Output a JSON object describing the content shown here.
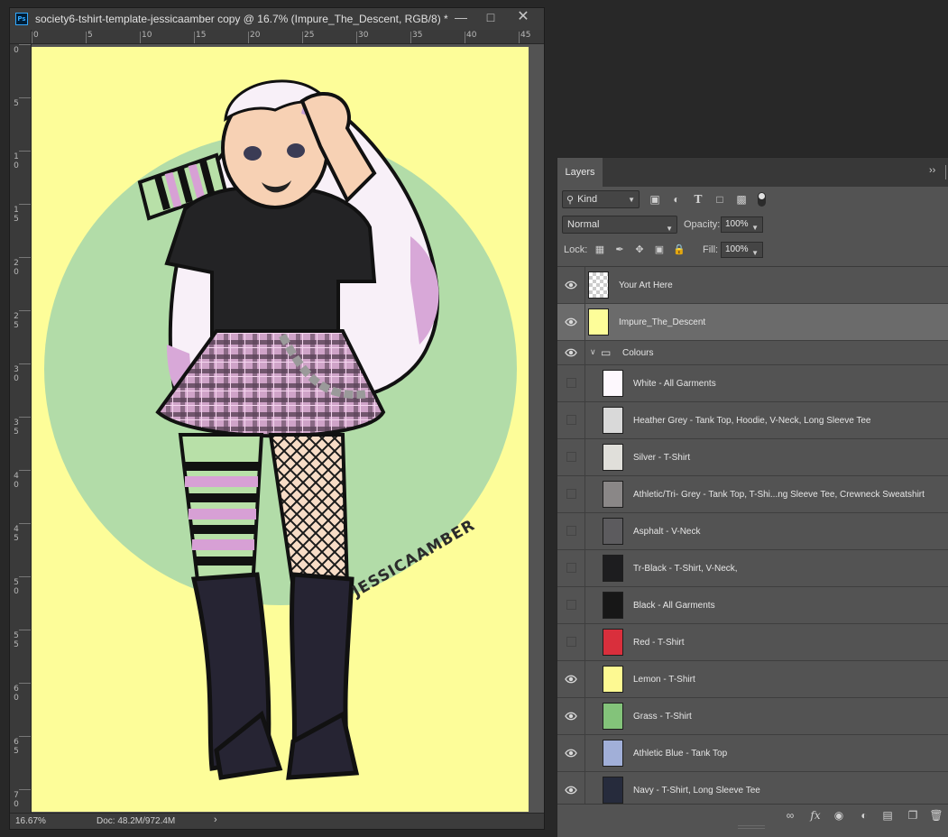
{
  "document": {
    "title": "society6-tshirt-template-jessicaamber copy @ 16.7% (Impure_The_Descent, RGB/8) *",
    "app_icon": "Ps",
    "zoom": "16.67%",
    "doc_size": "Doc: 48.2M/972.4M",
    "ruler_top": [
      "0",
      "5",
      "10",
      "15",
      "20",
      "25",
      "30",
      "35",
      "40",
      "45"
    ],
    "ruler_left": [
      "0",
      "5",
      "10",
      "15",
      "20",
      "25",
      "30",
      "35",
      "40",
      "45",
      "50",
      "55",
      "60",
      "65",
      "70"
    ],
    "artwork_signature": "JESSICAAMBER",
    "canvas_color": "#fdfd99",
    "circle_color": "#b2dca8"
  },
  "layers_panel": {
    "tab": "Layers",
    "menu_icon": "double-chevron-right-icon",
    "filter_kind": "Kind",
    "blend_mode": "Normal",
    "opacity_label": "Opacity:",
    "opacity": "100%",
    "lock_label": "Lock:",
    "fill_label": "Fill:",
    "fill": "100%",
    "layers": [
      {
        "name": "Your Art Here",
        "visible": true,
        "thumb": "#ffffff",
        "transparent": true,
        "indent": 0,
        "selected": false
      },
      {
        "name": "Impure_The_Descent",
        "visible": true,
        "thumb": "#fdfd99",
        "indent": 0,
        "selected": true
      },
      {
        "name": "Colours",
        "visible": true,
        "group": true,
        "indent": 0,
        "selected": false
      },
      {
        "name": "White - All Garments",
        "visible": false,
        "thumb": "#fdf8fd",
        "indent": 1
      },
      {
        "name": "Heather Grey - Tank Top, Hoodie, V-Neck, Long Sleeve Tee",
        "visible": false,
        "thumb": "#d9d9d9",
        "indent": 1
      },
      {
        "name": "Silver - T-Shirt",
        "visible": false,
        "thumb": "#e0dfda",
        "indent": 1
      },
      {
        "name": "Athletic/Tri- Grey - Tank Top, T-Shi...ng Sleeve Tee, Crewneck Sweatshirt",
        "visible": false,
        "thumb": "#8a8787",
        "indent": 1
      },
      {
        "name": "Asphalt - V-Neck",
        "visible": false,
        "thumb": "#5c5b5e",
        "indent": 1
      },
      {
        "name": "Tr-Black - T-Shirt, V-Neck,",
        "visible": false,
        "thumb": "#1d1d1f",
        "indent": 1
      },
      {
        "name": "Black - All Garments",
        "visible": false,
        "thumb": "#171717",
        "indent": 1
      },
      {
        "name": "Red - T-Shirt",
        "visible": false,
        "thumb": "#d92f3c",
        "indent": 1
      },
      {
        "name": "Lemon - T-Shirt",
        "visible": true,
        "thumb": "#fdf992",
        "indent": 1
      },
      {
        "name": "Grass - T-Shirt",
        "visible": true,
        "thumb": "#83c37a",
        "indent": 1
      },
      {
        "name": "Athletic Blue - Tank Top",
        "visible": true,
        "thumb": "#a1afd8",
        "indent": 1
      },
      {
        "name": "Navy - T-Shirt, Long Sleeve Tee",
        "visible": true,
        "thumb": "#262b3c",
        "indent": 1
      }
    ],
    "footer_icons": [
      "link-icon",
      "fx-icon",
      "mask-icon",
      "adjustment-icon",
      "folder-icon",
      "new-layer-icon",
      "trash-icon"
    ]
  }
}
